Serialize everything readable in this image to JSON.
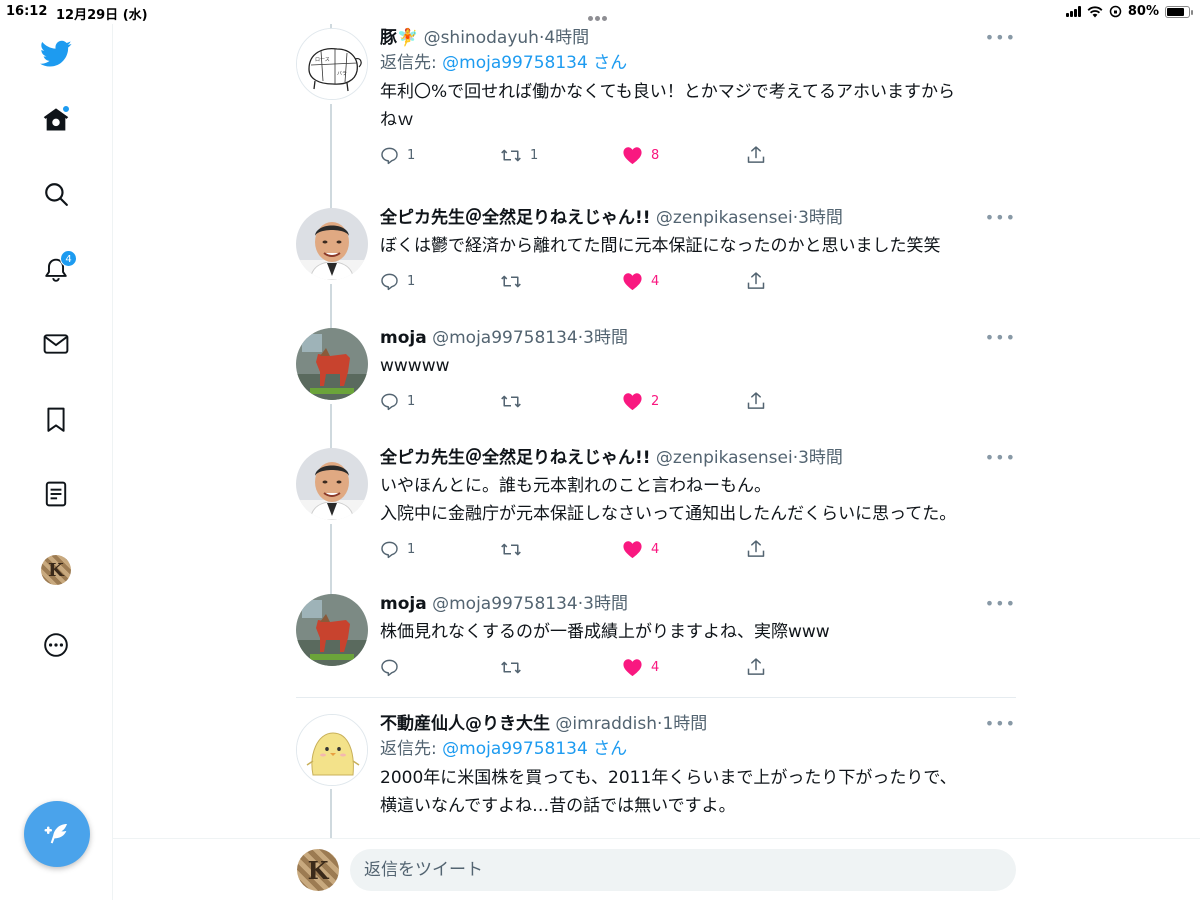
{
  "status_bar": {
    "time": "16:12",
    "date": "12月29日 (水)",
    "battery": "80%"
  },
  "sidebar": {
    "notifications_badge": "4"
  },
  "tweets": [
    {
      "name": "豚🧚",
      "handle": "@shinodayuh",
      "time": "4時間",
      "reply_label": "返信先: ",
      "reply_to": "@moja99758134 さん",
      "lines": [
        "年利〇%で回せれば働かなくても良い！とかマジで考えてるアホいますから",
        "ねｗ"
      ],
      "replies": "1",
      "retweets": "1",
      "likes": "8"
    },
    {
      "name": "全ピカ先生＠全然足りねえじゃん!!",
      "handle": "@zenpikasensei",
      "time": "3時間",
      "lines": [
        "ぼくは鬱で経済から離れてた間に元本保証になったのかと思いました笑笑"
      ],
      "replies": "1",
      "retweets": "",
      "likes": "4"
    },
    {
      "name": "moja",
      "handle": "@moja99758134",
      "time": "3時間",
      "lines": [
        "wwwww"
      ],
      "replies": "1",
      "retweets": "",
      "likes": "2"
    },
    {
      "name": "全ピカ先生＠全然足りねえじゃん!!",
      "handle": "@zenpikasensei",
      "time": "3時間",
      "lines": [
        "いやほんとに。誰も元本割れのこと言わねーもん。",
        "入院中に金融庁が元本保証しなさいって通知出したんだくらいに思ってた。"
      ],
      "replies": "1",
      "retweets": "",
      "likes": "4"
    },
    {
      "name": "moja",
      "handle": "@moja99758134",
      "time": "3時間",
      "lines": [
        "株価見れなくするのが一番成績上がりますよね、実際www"
      ],
      "replies": "",
      "retweets": "",
      "likes": "4"
    },
    {
      "name": "不動産仙人@りき大生",
      "handle": "@imraddish",
      "time": "1時間",
      "reply_label": "返信先: ",
      "reply_to": "@moja99758134 さん",
      "lines": [
        "2000年に米国株を買っても、2011年くらいまで上がったり下がったりで、",
        "横這いなんですよね…昔の話では無いですよ。"
      ]
    }
  ],
  "reply_bar": {
    "placeholder": "返信をツイート"
  },
  "colors": {
    "accent": "#1d9bf0",
    "like": "#f91880",
    "secondary_text": "#536471"
  }
}
